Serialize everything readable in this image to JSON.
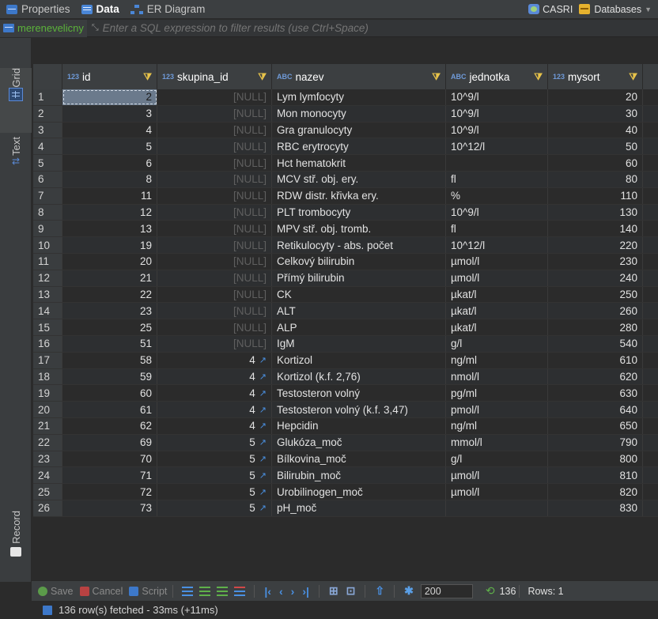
{
  "tabs": [
    {
      "label": "Properties",
      "icon": "properties-icon"
    },
    {
      "label": "Data",
      "icon": "data-icon"
    },
    {
      "label": "ER Diagram",
      "icon": "er-diagram-icon"
    }
  ],
  "connection": {
    "name": "CASRI",
    "databases_label": "Databases"
  },
  "filter": {
    "table_name": "merenevelicny",
    "placeholder": "Enter a SQL expression to filter results (use Ctrl+Space)"
  },
  "side_tabs": {
    "grid": "Grid",
    "text": "Text",
    "record": "Record"
  },
  "columns": [
    {
      "name": "id",
      "type": "123"
    },
    {
      "name": "skupina_id",
      "type": "123"
    },
    {
      "name": "nazev",
      "type": "ABC"
    },
    {
      "name": "jednotka",
      "type": "ABC"
    },
    {
      "name": "mysort",
      "type": "123"
    }
  ],
  "rows": [
    {
      "n": "1",
      "id": "2",
      "skupina_id": "[NULL]",
      "nazev": "Lym lymfocyty",
      "jednotka": "10^9/l",
      "mysort": "20"
    },
    {
      "n": "2",
      "id": "3",
      "skupina_id": "[NULL]",
      "nazev": "Mon monocyty",
      "jednotka": "10^9/l",
      "mysort": "30"
    },
    {
      "n": "3",
      "id": "4",
      "skupina_id": "[NULL]",
      "nazev": "Gra granulocyty",
      "jednotka": "10^9/l",
      "mysort": "40"
    },
    {
      "n": "4",
      "id": "5",
      "skupina_id": "[NULL]",
      "nazev": "RBC erytrocyty",
      "jednotka": "10^12/l",
      "mysort": "50"
    },
    {
      "n": "5",
      "id": "6",
      "skupina_id": "[NULL]",
      "nazev": "Hct hematokrit",
      "jednotka": "",
      "mysort": "60"
    },
    {
      "n": "6",
      "id": "8",
      "skupina_id": "[NULL]",
      "nazev": "MCV stř. obj. ery.",
      "jednotka": "fl",
      "mysort": "80"
    },
    {
      "n": "7",
      "id": "11",
      "skupina_id": "[NULL]",
      "nazev": "RDW distr. křivka ery.",
      "jednotka": "%",
      "mysort": "110"
    },
    {
      "n": "8",
      "id": "12",
      "skupina_id": "[NULL]",
      "nazev": "PLT trombocyty",
      "jednotka": "10^9/l",
      "mysort": "130"
    },
    {
      "n": "9",
      "id": "13",
      "skupina_id": "[NULL]",
      "nazev": "MPV stř. obj. tromb.",
      "jednotka": "fl",
      "mysort": "140"
    },
    {
      "n": "10",
      "id": "19",
      "skupina_id": "[NULL]",
      "nazev": "Retikulocyty - abs. počet",
      "jednotka": "10^12/l",
      "mysort": "220"
    },
    {
      "n": "11",
      "id": "20",
      "skupina_id": "[NULL]",
      "nazev": "Celkový bilirubin",
      "jednotka": "µmol/l",
      "mysort": "230"
    },
    {
      "n": "12",
      "id": "21",
      "skupina_id": "[NULL]",
      "nazev": "Přímý bilirubin",
      "jednotka": "µmol/l",
      "mysort": "240"
    },
    {
      "n": "13",
      "id": "22",
      "skupina_id": "[NULL]",
      "nazev": "CK",
      "jednotka": "µkat/l",
      "mysort": "250"
    },
    {
      "n": "14",
      "id": "23",
      "skupina_id": "[NULL]",
      "nazev": "ALT",
      "jednotka": "µkat/l",
      "mysort": "260"
    },
    {
      "n": "15",
      "id": "25",
      "skupina_id": "[NULL]",
      "nazev": "ALP",
      "jednotka": "µkat/l",
      "mysort": "280"
    },
    {
      "n": "16",
      "id": "51",
      "skupina_id": "[NULL]",
      "nazev": "IgM",
      "jednotka": "g/l",
      "mysort": "540"
    },
    {
      "n": "17",
      "id": "58",
      "skupina_id": "4",
      "nazev": "Kortizol",
      "jednotka": "ng/ml",
      "mysort": "610"
    },
    {
      "n": "18",
      "id": "59",
      "skupina_id": "4",
      "nazev": "Kortizol (k.f. 2,76)",
      "jednotka": "nmol/l",
      "mysort": "620"
    },
    {
      "n": "19",
      "id": "60",
      "skupina_id": "4",
      "nazev": "Testosteron volný",
      "jednotka": "pg/ml",
      "mysort": "630"
    },
    {
      "n": "20",
      "id": "61",
      "skupina_id": "4",
      "nazev": "Testosteron volný (k.f. 3,47)",
      "jednotka": "pmol/l",
      "mysort": "640"
    },
    {
      "n": "21",
      "id": "62",
      "skupina_id": "4",
      "nazev": "Hepcidin",
      "jednotka": "ng/ml",
      "mysort": "650"
    },
    {
      "n": "22",
      "id": "69",
      "skupina_id": "5",
      "nazev": "Glukóza_moč",
      "jednotka": "mmol/l",
      "mysort": "790"
    },
    {
      "n": "23",
      "id": "70",
      "skupina_id": "5",
      "nazev": "Bílkovina_moč",
      "jednotka": "g/l",
      "mysort": "800"
    },
    {
      "n": "24",
      "id": "71",
      "skupina_id": "5",
      "nazev": "Bilirubin_moč",
      "jednotka": "µmol/l",
      "mysort": "810"
    },
    {
      "n": "25",
      "id": "72",
      "skupina_id": "5",
      "nazev": "Urobilinogen_moč",
      "jednotka": "µmol/l",
      "mysort": "820"
    },
    {
      "n": "26",
      "id": "73",
      "skupina_id": "5",
      "nazev": "pH_moč",
      "jednotka": "",
      "mysort": "830"
    }
  ],
  "toolbar": {
    "save": "Save",
    "cancel": "Cancel",
    "script": "Script",
    "fetch_size": "200",
    "row_count": "136",
    "rows_label": "Rows: 1"
  },
  "status": {
    "message": "136 row(s) fetched - 33ms (+11ms)"
  }
}
